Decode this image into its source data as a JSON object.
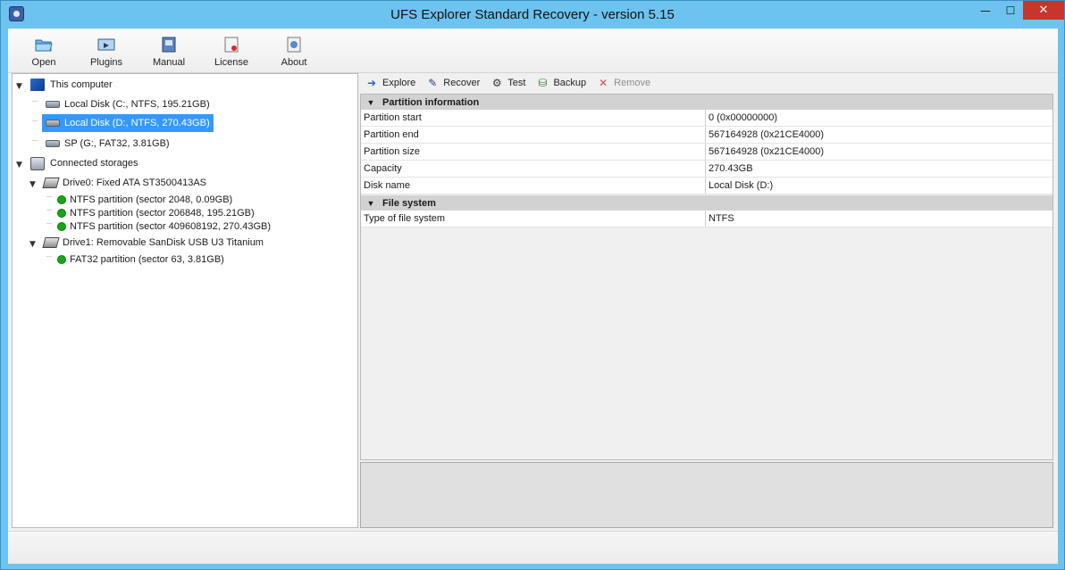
{
  "window": {
    "title": "UFS Explorer Standard Recovery - version 5.15",
    "minimize": "—",
    "maximize": "☐",
    "close": "✕"
  },
  "toolbar": [
    {
      "label": "Open",
      "icon": "open-folder-icon"
    },
    {
      "label": "Plugins",
      "icon": "plugins-icon"
    },
    {
      "label": "Manual",
      "icon": "manual-book-icon"
    },
    {
      "label": "License",
      "icon": "license-icon"
    },
    {
      "label": "About",
      "icon": "about-icon"
    }
  ],
  "tree": {
    "this_computer": "This computer",
    "local_c": "Local Disk (C:, NTFS, 195.21GB)",
    "local_d": "Local Disk (D:, NTFS, 270.43GB)",
    "sp_g": "SP (G:, FAT32, 3.81GB)",
    "connected": "Connected storages",
    "drive0": "Drive0: Fixed ATA ST3500413AS",
    "ntfs1": "NTFS partition (sector 2048, 0.09GB)",
    "ntfs2": "NTFS partition (sector 206848, 195.21GB)",
    "ntfs3": "NTFS partition (sector 409608192, 270.43GB)",
    "drive1": "Drive1: Removable SanDisk USB U3 Titanium",
    "fat32": "FAT32 partition (sector 63, 3.81GB)"
  },
  "actions": {
    "explore": "Explore",
    "recover": "Recover",
    "test": "Test",
    "backup": "Backup",
    "remove": "Remove"
  },
  "partition_info": {
    "header": "Partition information",
    "rows": [
      {
        "key": "Partition start",
        "value": "0 (0x00000000)"
      },
      {
        "key": "Partition end",
        "value": "567164928 (0x21CE4000)"
      },
      {
        "key": "Partition size",
        "value": "567164928 (0x21CE4000)"
      },
      {
        "key": "Capacity",
        "value": "270.43GB"
      },
      {
        "key": "Disk name",
        "value": "Local Disk (D:)"
      }
    ]
  },
  "file_system": {
    "header": "File system",
    "rows": [
      {
        "key": "Type of file system",
        "value": "NTFS"
      }
    ]
  }
}
